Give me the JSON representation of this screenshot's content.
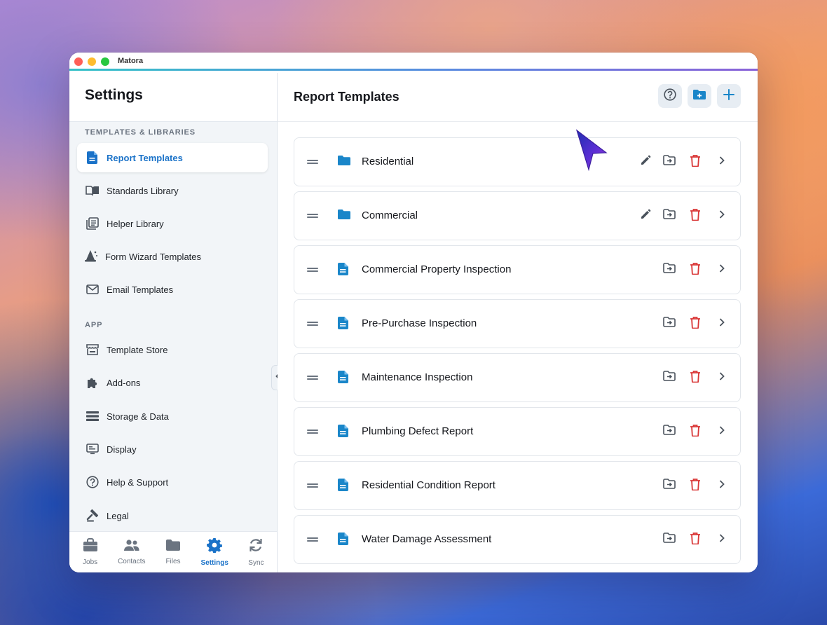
{
  "window": {
    "app_title": "Matora"
  },
  "sidebar": {
    "title": "Settings",
    "sections": [
      {
        "label": "TEMPLATES & LIBRARIES"
      },
      {
        "label": "APP"
      }
    ],
    "items": [
      {
        "label": "Report Templates",
        "icon": "document-icon"
      },
      {
        "label": "Standards Library",
        "icon": "open-book-icon"
      },
      {
        "label": "Helper Library",
        "icon": "library-stack-icon"
      },
      {
        "label": "Form Wizard Templates",
        "icon": "wizard-hat-icon"
      },
      {
        "label": "Email Templates",
        "icon": "envelope-icon"
      },
      {
        "label": "Template Store",
        "icon": "storefront-icon"
      },
      {
        "label": "Add-ons",
        "icon": "puzzle-icon"
      },
      {
        "label": "Storage & Data",
        "icon": "storage-list-icon"
      },
      {
        "label": "Display",
        "icon": "display-icon"
      },
      {
        "label": "Help & Support",
        "icon": "help-circle-icon"
      },
      {
        "label": "Legal",
        "icon": "gavel-icon"
      }
    ],
    "active_item": "Report Templates"
  },
  "tabbar": {
    "tabs": [
      {
        "label": "Jobs",
        "icon": "briefcase-icon"
      },
      {
        "label": "Contacts",
        "icon": "people-icon"
      },
      {
        "label": "Files",
        "icon": "folder-icon"
      },
      {
        "label": "Settings",
        "icon": "gear-icon"
      },
      {
        "label": "Sync",
        "icon": "sync-icon"
      }
    ],
    "active_tab": "Settings"
  },
  "main": {
    "title": "Report Templates",
    "header_buttons": [
      "help-icon",
      "new-folder-icon",
      "add-icon"
    ],
    "rows": [
      {
        "label": "Residential",
        "kind": "folder"
      },
      {
        "label": "Commercial",
        "kind": "folder"
      },
      {
        "label": "Commercial Property Inspection",
        "kind": "template"
      },
      {
        "label": "Pre-Purchase Inspection",
        "kind": "template"
      },
      {
        "label": "Maintenance Inspection",
        "kind": "template"
      },
      {
        "label": "Plumbing Defect Report",
        "kind": "template"
      },
      {
        "label": "Residential Condition Report",
        "kind": "template"
      },
      {
        "label": "Water Damage Assessment",
        "kind": "template"
      }
    ]
  },
  "colors": {
    "accent": "#1a72c8",
    "folder_icon": "#1a86c9",
    "delete_icon": "#d93636",
    "cursor": "#5b2fd4"
  }
}
